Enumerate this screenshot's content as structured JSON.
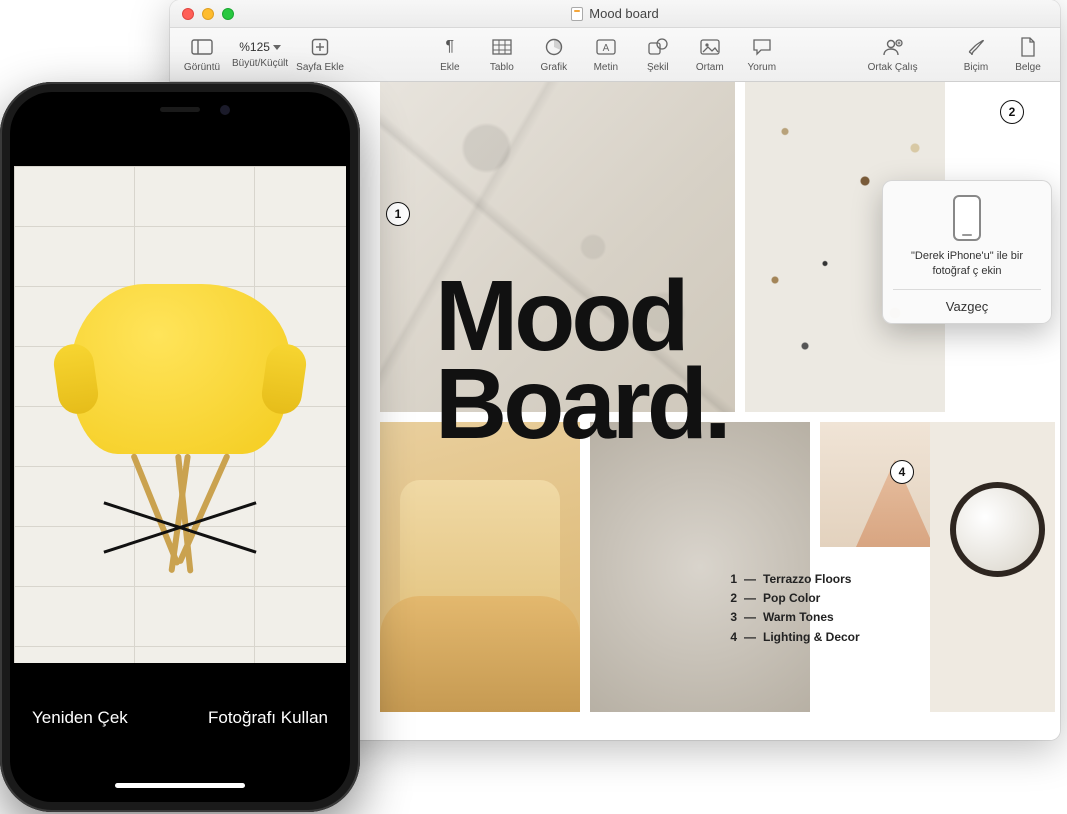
{
  "window": {
    "title": "Mood board"
  },
  "toolbar": {
    "view_label": "Görüntü",
    "zoom_value": "%125",
    "zoom_label": "Büyüt/Küçült",
    "addpage_label": "Sayfa Ekle",
    "insert_label": "Ekle",
    "table_label": "Tablo",
    "chart_label": "Grafik",
    "text_label": "Metin",
    "shape_label": "Şekil",
    "media_label": "Ortam",
    "comment_label": "Yorum",
    "collab_label": "Ortak Çalış",
    "format_label": "Biçim",
    "document_label": "Belge"
  },
  "document": {
    "heading_line1": "Mood",
    "heading_line2": "Board.",
    "badges": {
      "b1": "1",
      "b2": "2",
      "b4": "4"
    },
    "legend": [
      {
        "n": "1",
        "dash": "—",
        "text": "Terrazzo Floors"
      },
      {
        "n": "2",
        "dash": "—",
        "text": "Pop Color"
      },
      {
        "n": "3",
        "dash": "—",
        "text": "Warm Tones"
      },
      {
        "n": "4",
        "dash": "—",
        "text": "Lighting & Decor"
      }
    ]
  },
  "popover": {
    "message": "\"Derek iPhone'u\" ile bir fotoğraf ç ekin",
    "cancel": "Vazgeç"
  },
  "phone": {
    "retake": "Yeniden Çek",
    "use": "Fotoğrafı Kullan"
  }
}
